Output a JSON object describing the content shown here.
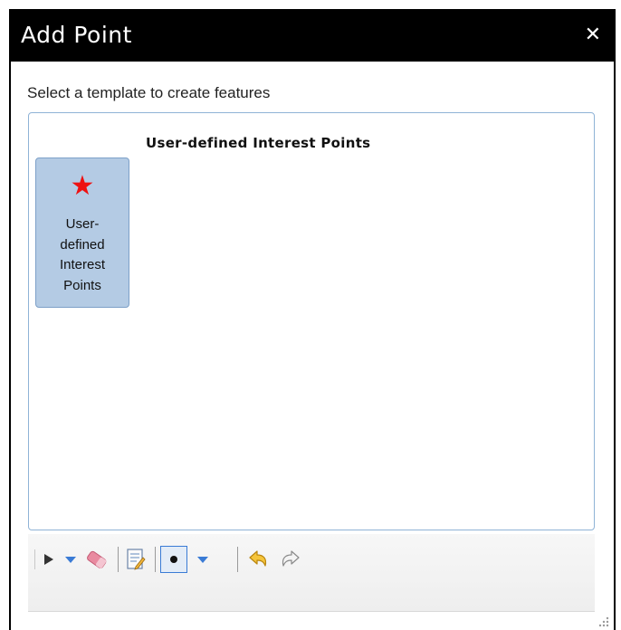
{
  "dialog": {
    "title": "Add Point",
    "close_glyph": "✕"
  },
  "instruction": "Select a template to create features",
  "picker": {
    "group_heading": "User-defined Interest Points",
    "templates": [
      {
        "label_lines": [
          "User-",
          "defined",
          "Interest",
          "Points"
        ],
        "icon": "star-icon",
        "icon_color": "#ee1111",
        "selected": true
      }
    ]
  },
  "toolbar": {
    "tools": [
      {
        "name": "select-tool",
        "icon": "arrow-cursor-icon"
      },
      {
        "name": "select-options-dropdown",
        "icon": "chevron-down-icon"
      },
      {
        "name": "delete-tool",
        "icon": "eraser-icon"
      },
      {
        "name": "attributes-tool",
        "icon": "edit-document-icon"
      },
      {
        "name": "point-tool",
        "icon": "point-icon",
        "active": true
      },
      {
        "name": "point-options-dropdown",
        "icon": "chevron-down-icon"
      },
      {
        "name": "undo-button",
        "icon": "undo-icon"
      },
      {
        "name": "redo-button",
        "icon": "redo-icon"
      }
    ]
  },
  "colors": {
    "titlebar": "#000000",
    "tile_selected": "#b4cbe4",
    "dropdown_arrow": "#3a7bd5",
    "undo_arrow": "#f2b21b"
  }
}
